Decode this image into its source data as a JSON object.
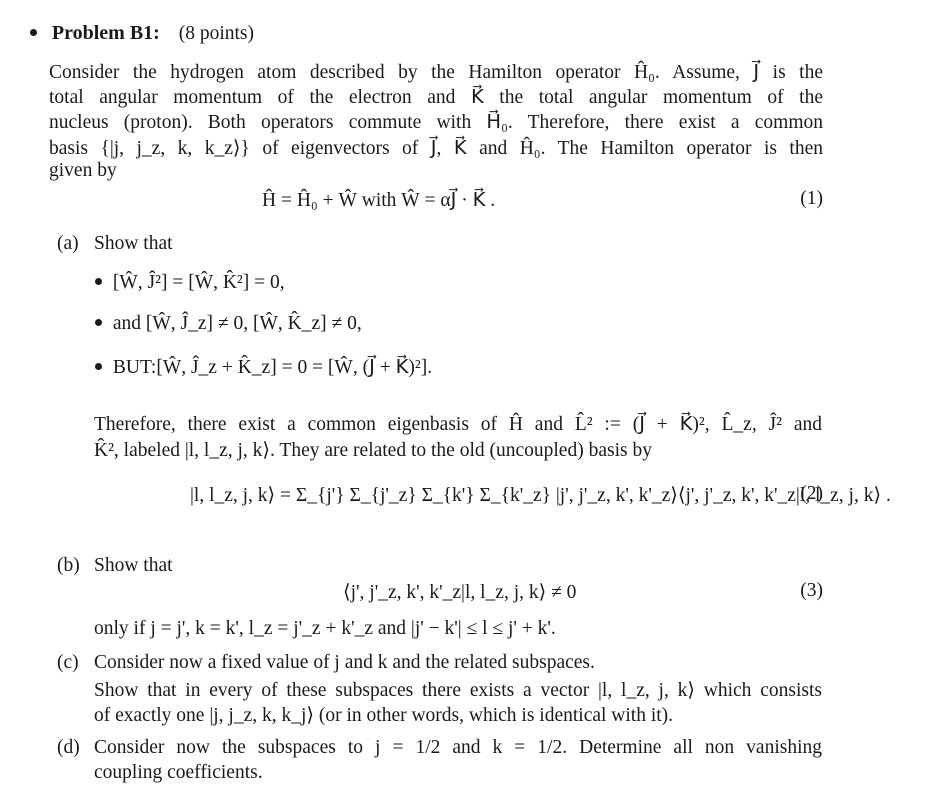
{
  "problem": {
    "bullet": "•",
    "title": "Problem B1:",
    "points": "(8 points)"
  },
  "intro": {
    "lines": [
      "Consider the hydrogen atom described by the Hamilton operator Ĥ₀. Assume, J⃗ is the",
      "total angular momentum of the electron and K⃗ the total angular momentum of the",
      "nucleus (proton). Both operators commute with H⃗₀. Therefore, there exist a common",
      "basis {|j, j_z, k, k_z⟩} of eigenvectors of J⃗, K⃗ and Ĥ₀. The Hamilton operator is then",
      "given by"
    ]
  },
  "equations": {
    "eq1": {
      "text": "Ĥ = Ĥ₀ + Ŵ   with   Ŵ = αJ⃗ · K⃗ .",
      "number": "(1)"
    },
    "eq2": {
      "text": "|l, l_z, j, k⟩ = Σ_{j'} Σ_{j'_z} Σ_{k'} Σ_{k'_z} |j', j'_z, k', k'_z⟩⟨j', j'_z, k', k'_z|l, l_z, j, k⟩ .",
      "number": "(2)"
    },
    "eq3": {
      "text": "⟨j', j'_z, k', k'_z|l, l_z, j, k⟩ ≠ 0",
      "number": "(3)"
    }
  },
  "parts": {
    "a": {
      "label": "(a)",
      "lead": "Show that",
      "bullets": [
        "[Ŵ, Ĵ²] = [Ŵ, K̂²] = 0,",
        "and [Ŵ, Ĵ_z] ≠ 0, [Ŵ, K̂_z] ≠ 0,",
        "BUT:[Ŵ, Ĵ_z + K̂_z] = 0 = [Ŵ, (J⃗ + K⃗)²]."
      ],
      "follow_lines": [
        "Therefore, there exist a common eigenbasis of Ĥ and L̂² := (J⃗ + K⃗)², L̂_z, Ĵ² and",
        "K̂², labeled |l, l_z, j, k⟩. They are related to the old (uncoupled) basis by"
      ]
    },
    "b": {
      "label": "(b)",
      "lead": "Show that",
      "condition": "only if j = j', k = k', l_z = j'_z + k'_z and |j' − k'| ≤ l ≤ j' + k'."
    },
    "c": {
      "label": "(c)",
      "lines": [
        "Consider now a fixed value of j and k and the related subspaces.",
        "Show that in every of these subspaces there exists a vector |l, l_z, j, k⟩ which consists",
        "of exactly one |j, j_z, k, k_j⟩ (or in other words, which is identical with it)."
      ]
    },
    "d": {
      "label": "(d)",
      "lines": [
        "Consider now the subspaces to j = 1/2 and k = 1/2. Determine all non vanishing",
        "coupling coefficients."
      ]
    }
  }
}
